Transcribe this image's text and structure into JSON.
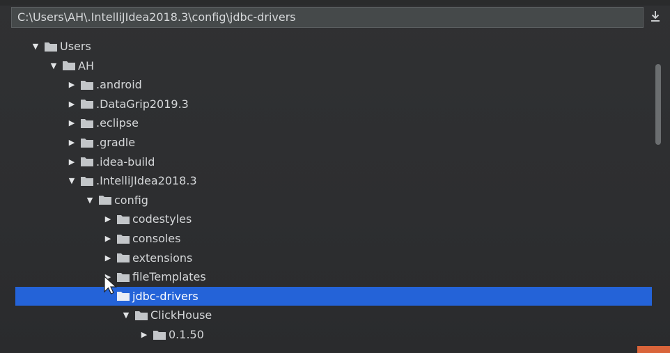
{
  "path_bar": {
    "value": "C:\\Users\\AH\\.IntelliJIdea2018.3\\config\\jdbc-drivers"
  },
  "icons": {
    "download": "download-icon",
    "folder": "folder-icon",
    "expanded": "caret-down-icon",
    "collapsed": "caret-right-icon"
  },
  "colors": {
    "selection": "#2463d8",
    "background": "#2d2e30",
    "text": "#d4d6d8",
    "folder": "#c3c6c9"
  },
  "tree": [
    {
      "label": "Users",
      "depth": 0,
      "expanded": true
    },
    {
      "label": "AH",
      "depth": 1,
      "expanded": true
    },
    {
      "label": ".android",
      "depth": 2,
      "expanded": false
    },
    {
      "label": ".DataGrip2019.3",
      "depth": 2,
      "expanded": false
    },
    {
      "label": ".eclipse",
      "depth": 2,
      "expanded": false
    },
    {
      "label": ".gradle",
      "depth": 2,
      "expanded": false
    },
    {
      "label": ".idea-build",
      "depth": 2,
      "expanded": false
    },
    {
      "label": ".IntelliJIdea2018.3",
      "depth": 2,
      "expanded": true
    },
    {
      "label": "config",
      "depth": 3,
      "expanded": true
    },
    {
      "label": "codestyles",
      "depth": 4,
      "expanded": false
    },
    {
      "label": "consoles",
      "depth": 4,
      "expanded": false
    },
    {
      "label": "extensions",
      "depth": 4,
      "expanded": false
    },
    {
      "label": "fileTemplates",
      "depth": 4,
      "expanded": false
    },
    {
      "label": "jdbc-drivers",
      "depth": 4,
      "expanded": true,
      "selected": true
    },
    {
      "label": "ClickHouse",
      "depth": 5,
      "expanded": true
    },
    {
      "label": "0.1.50",
      "depth": 6,
      "expanded": false
    }
  ]
}
